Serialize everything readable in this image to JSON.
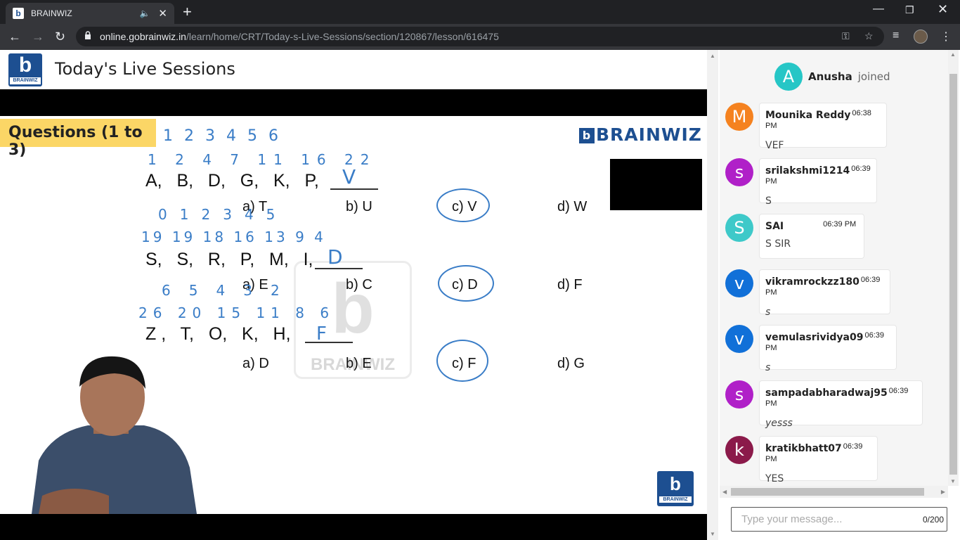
{
  "browser": {
    "tab_title": "BRAINWIZ",
    "favicon_letter": "b",
    "url_host": "online.gobrainwiz.in",
    "url_path": "/learn/home/CRT/Today-s-Live-Sessions/section/120867/lesson/616475",
    "icons": [
      "back-icon",
      "forward-icon",
      "reload-icon",
      "lock-icon",
      "key-icon",
      "star-icon",
      "media-icon",
      "profile-avatar",
      "menu-icon"
    ]
  },
  "header": {
    "logo_letter": "b",
    "logo_text": "BRAINWIZ",
    "title": "Today's Live Sessions"
  },
  "slide": {
    "badge": "Questions (1 to 3)",
    "brand": "BRAINWIZ",
    "q1": {
      "sequence": "A,   B,   D,   G,   K,   P,",
      "options": [
        "a) T",
        "b) U",
        "c) V",
        "d) W"
      ],
      "answer_written": "V",
      "numbers_top": [
        "1",
        "2",
        "3",
        "4",
        "5",
        "6"
      ],
      "numbers_bottom": [
        "1",
        "2",
        "4",
        "7",
        "11",
        "16",
        "22"
      ]
    },
    "q2": {
      "sequence": "S,   S,   R,   P,   M,   I,",
      "options": [
        "a) E",
        "b) C",
        "c) D",
        "d) F"
      ],
      "answer_written": "D",
      "numbers_top": [
        "0",
        "1",
        "2",
        "3",
        "4",
        "5"
      ],
      "numbers_bottom": [
        "19",
        "19",
        "18",
        "16",
        "13",
        "9",
        "4"
      ]
    },
    "q3": {
      "sequence": "Z ,   T,   O,   K,   H,",
      "options": [
        "a) D",
        "b) E",
        "c) F",
        "d) G"
      ],
      "answer_written": "F",
      "numbers_top": [
        "6",
        "5",
        "4",
        "3",
        "2"
      ],
      "numbers_bottom": [
        "26",
        "20",
        "15",
        "11",
        "8",
        "6"
      ]
    },
    "watermark": "BRAINWIZ"
  },
  "chat": {
    "joined": {
      "initial": "A",
      "name": "Anusha",
      "text": "joined",
      "color": "#26c6c6"
    },
    "messages": [
      {
        "initial": "M",
        "name": "Mounika Reddy",
        "time": "06:38 PM",
        "text": "VEF",
        "color": "#f5821f",
        "italic": false
      },
      {
        "initial": "s",
        "name": "srilakshmi1214",
        "time": "06:39 PM",
        "text": "S",
        "color": "#b020c8",
        "italic": false
      },
      {
        "initial": "S",
        "name": "SAI",
        "time": "06:39 PM",
        "text": "S SIR",
        "color": "#3ec9c9",
        "italic": false
      },
      {
        "initial": "v",
        "name": "vikramrockzz180",
        "time": "06:39 PM",
        "text": "s",
        "color": "#1170d8",
        "italic": true
      },
      {
        "initial": "v",
        "name": "vemulasrividya09",
        "time": "06:39 PM",
        "text": "s",
        "color": "#1170d8",
        "italic": true
      },
      {
        "initial": "s",
        "name": "sampadabharadwaj95",
        "time": "06:39 PM",
        "text": "yesss",
        "color": "#b020c8",
        "italic": true
      },
      {
        "initial": "k",
        "name": "kratikbhatt07",
        "time": "06:39 PM",
        "text": "YES",
        "color": "#8b1a4a",
        "italic": false
      }
    ],
    "input_placeholder": "Type your message...",
    "counter": "0/200"
  }
}
